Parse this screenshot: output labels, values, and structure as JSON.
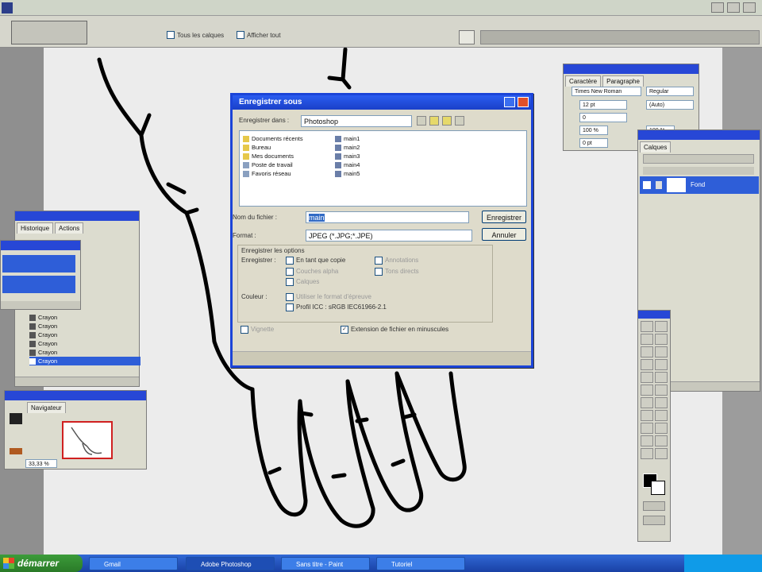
{
  "options_bar": {
    "view_all_label": "Tous les calques",
    "snap_label": "Afficher tout"
  },
  "character_panel": {
    "tabs": [
      "Caractère",
      "Paragraphe"
    ],
    "font": "Times New Roman",
    "style": "Regular",
    "size": "12 pt",
    "leading": "(Auto)",
    "tracking": "0",
    "scale_v": "100 %",
    "scale_h": "100 %",
    "baseline": "0 pt"
  },
  "layers_panel": {
    "tab": "Calques",
    "layer_name": "Fond"
  },
  "left_panel": {
    "tabs": [
      "Historique",
      "Actions"
    ],
    "rows": [
      "Crayon",
      "Crayon",
      "Crayon",
      "Crayon",
      "Crayon",
      "Crayon"
    ],
    "selected": "Crayon"
  },
  "navigator": {
    "tab": "Navigateur",
    "zoom": "33,33 %"
  },
  "dialog": {
    "title": "Enregistrer sous",
    "save_in_label": "Enregistrer dans :",
    "save_in_value": "Photoshop",
    "folders": [
      "Documents récents",
      "Bureau",
      "Mes documents",
      "Poste de travail",
      "Favoris réseau"
    ],
    "files": [
      "main1",
      "main2",
      "main3",
      "main4",
      "main5"
    ],
    "filename_label": "Nom du fichier :",
    "filename_value": "main",
    "format_label": "Format :",
    "format_value": "JPEG (*.JPG;*.JPE)",
    "save_button": "Enregistrer",
    "cancel_button": "Annuler",
    "options_title": "Enregistrer les options",
    "options_label": "Enregistrer :",
    "opt_copy": "En tant que copie",
    "opt_annotations": "Annotations",
    "opt_alpha": "Couches alpha",
    "opt_spot": "Tons directs",
    "opt_layers": "Calques",
    "color_label": "Couleur :",
    "color_proof": "Utiliser le format d'épreuve",
    "color_icc": "Profil ICC : sRGB IEC61966-2.1",
    "thumb_label": "Vignette",
    "lowercase_ext": "Extension de fichier en minuscules"
  },
  "taskbar": {
    "start": "démarrer",
    "items": [
      "Gmail",
      "Adobe Photoshop",
      "Sans titre - Paint",
      "Tutoriel"
    ]
  },
  "colors": {
    "title_blue": "#1b44d8",
    "canvas": "#ececec",
    "taskbar": "#2557c8"
  }
}
